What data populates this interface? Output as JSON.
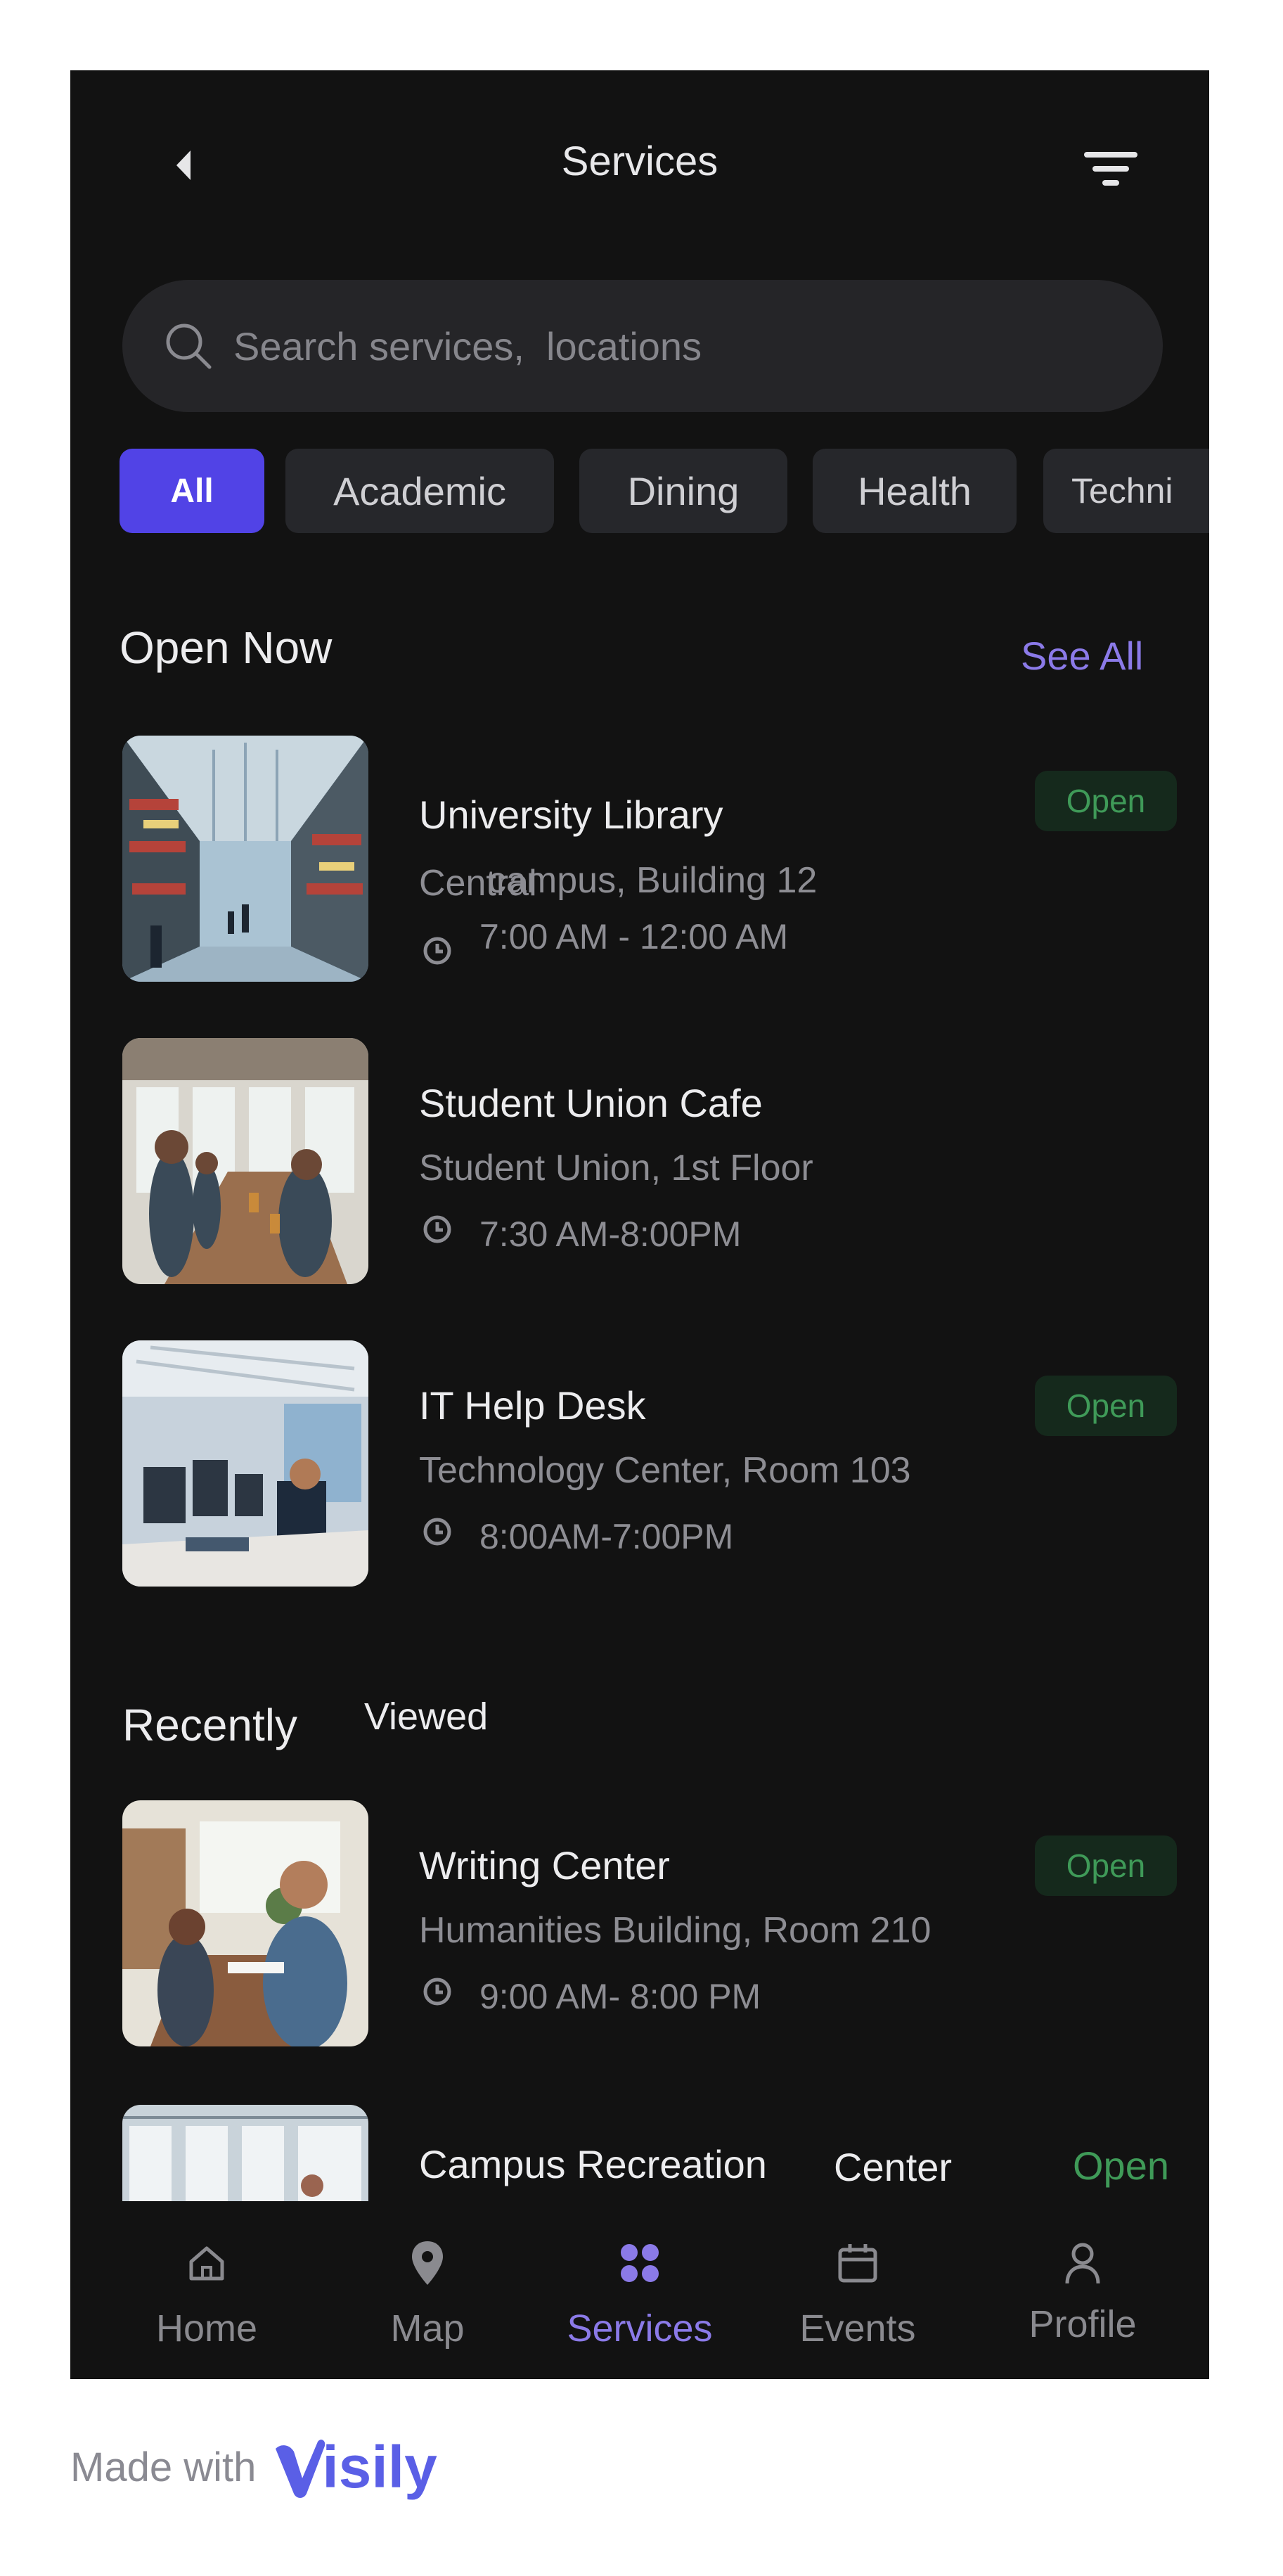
{
  "header": {
    "title": "Services",
    "back_icon": "chevron-left-icon",
    "filter_icon": "filter-icon"
  },
  "search": {
    "placeholder": "Search services,  locations"
  },
  "categories": [
    {
      "label": "All",
      "active": true
    },
    {
      "label": "Academic"
    },
    {
      "label": "Dining"
    },
    {
      "label": "Health"
    },
    {
      "label": "Techni"
    }
  ],
  "open_now": {
    "title": "Open Now",
    "see_all": "See All",
    "items": [
      {
        "name": "University Library",
        "location": "Central",
        "location_overlap": "campus, Building 12",
        "hours": "7:00 AM - 12:00 AM",
        "status": "Open"
      },
      {
        "name": "Student Union Cafe",
        "location": "Student Union, 1st Floor",
        "hours": "7:30 AM-8:00PM",
        "status": ""
      },
      {
        "name": "IT Help Desk",
        "location": "Technology Center, Room 103",
        "hours": "8:00AM-7:00PM",
        "status": "Open"
      }
    ]
  },
  "recently_viewed": {
    "title_part1": "Recently",
    "title_part2": "Viewed",
    "items": [
      {
        "name": "Writing Center",
        "location": "Humanities Building, Room 210",
        "hours": "9:00 AM- 8:00 PM",
        "status": "Open"
      },
      {
        "name_part1": "Campus Recreation",
        "name_part2": "Center",
        "status": "Open"
      }
    ]
  },
  "nav": [
    {
      "label": "Home",
      "icon": "home-icon"
    },
    {
      "label": "Map",
      "icon": "map-pin-icon"
    },
    {
      "label": "Services",
      "icon": "grid-icon",
      "active": true
    },
    {
      "label": "Events",
      "icon": "calendar-icon"
    },
    {
      "label": "Profile",
      "icon": "user-icon"
    }
  ],
  "footer": {
    "made_with": "Made with",
    "brand": "isily"
  },
  "colors": {
    "accent": "#5143e6",
    "accent_text": "#8b7ae8",
    "open_green": "#3f9a58",
    "background": "#121212"
  }
}
